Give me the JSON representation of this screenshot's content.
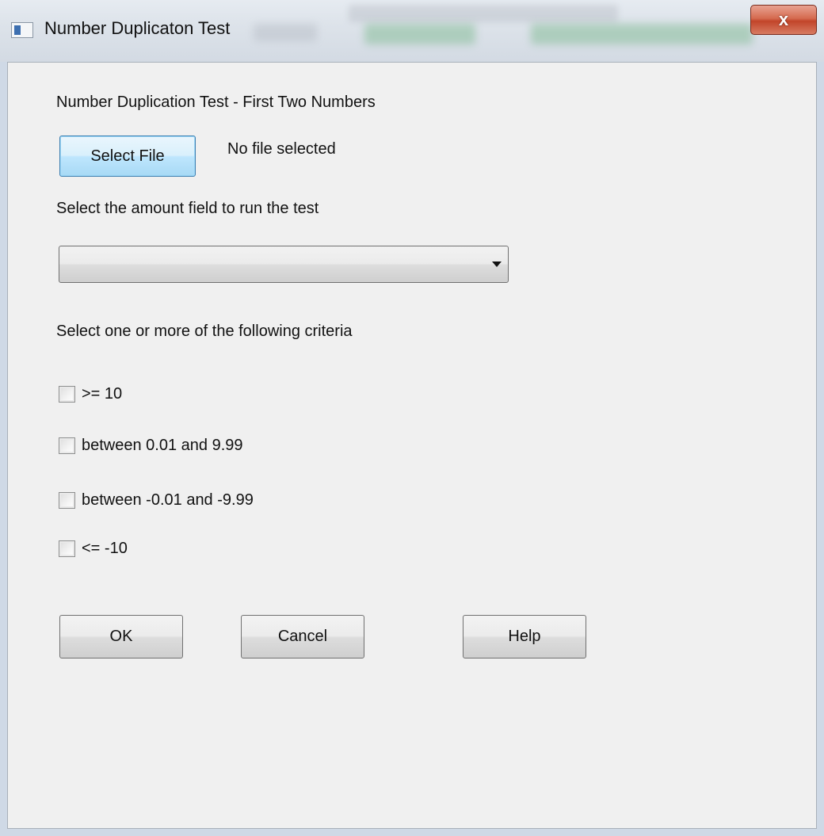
{
  "window": {
    "title": "Number Duplicaton Test",
    "close_label": "x"
  },
  "dialog": {
    "heading": "Number Duplication Test - First Two Numbers",
    "select_file_label": "Select File",
    "file_status": "No file selected",
    "amount_field_prompt": "Select the amount field to run the test",
    "amount_field_value": "",
    "criteria_prompt": "Select one or more of the following criteria",
    "criteria": [
      {
        "label": ">= 10",
        "checked": false
      },
      {
        "label": "between 0.01 and 9.99",
        "checked": false
      },
      {
        "label": "between -0.01 and -9.99",
        "checked": false
      },
      {
        "label": "<= -10",
        "checked": false
      }
    ],
    "ok_label": "OK",
    "cancel_label": "Cancel",
    "help_label": "Help"
  }
}
